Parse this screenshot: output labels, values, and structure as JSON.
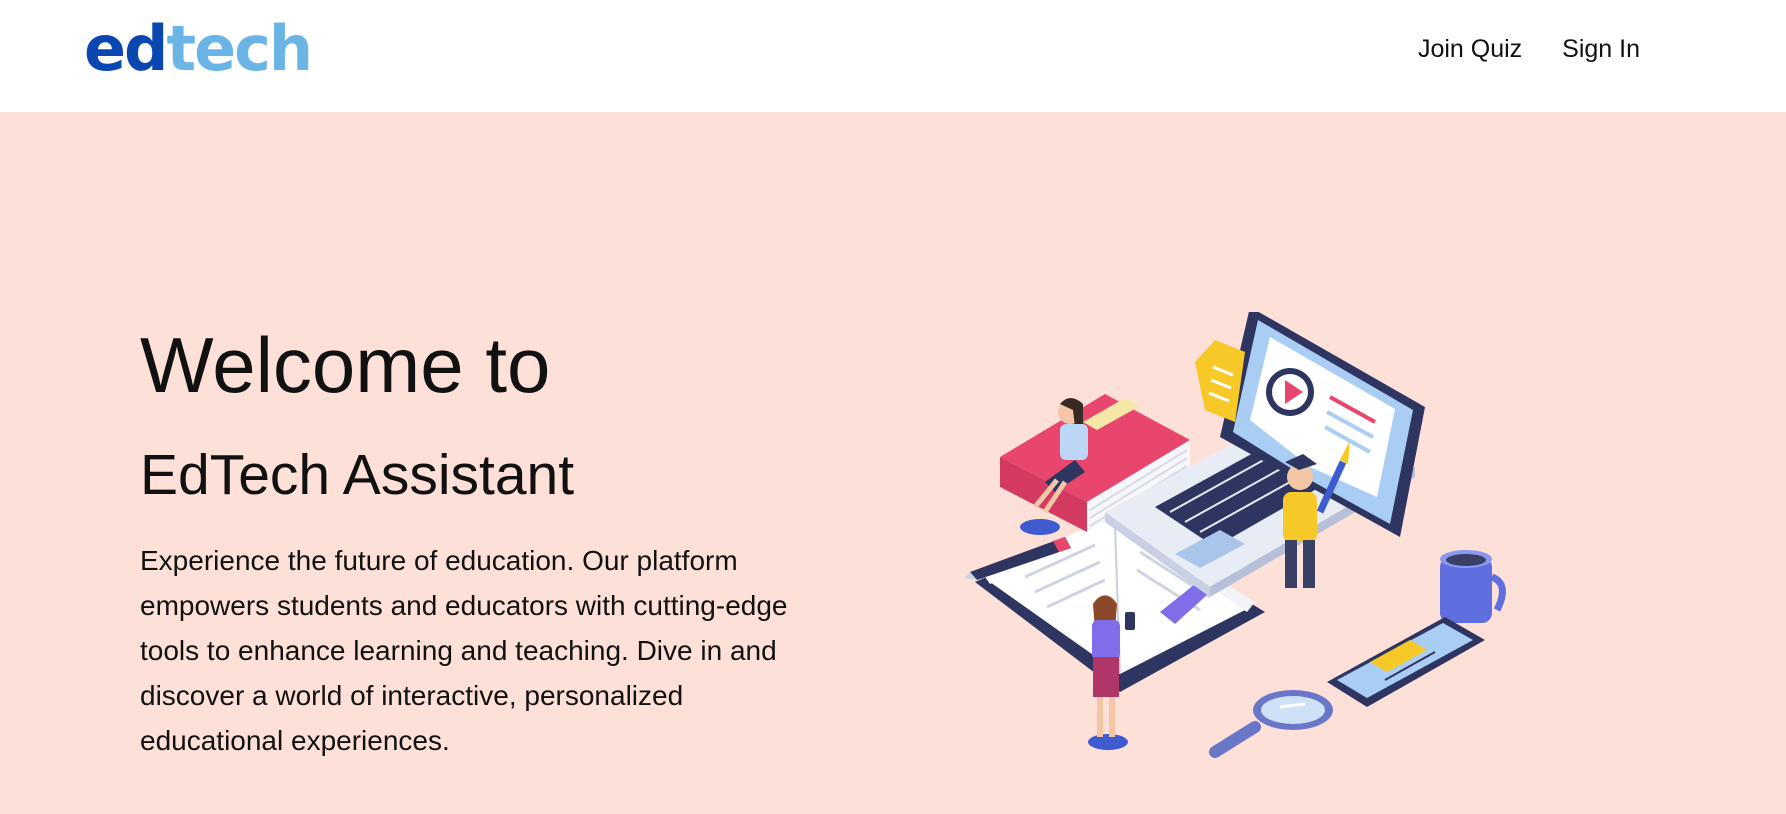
{
  "header": {
    "logo": {
      "part1": "ed",
      "part2": "tech"
    },
    "nav": [
      {
        "label": "Join Quiz"
      },
      {
        "label": "Sign In"
      }
    ]
  },
  "hero": {
    "title": "Welcome to",
    "subtitle": "EdTech Assistant",
    "description": "Experience the future of education. Our platform empowers students and educators with cutting-edge tools to enhance learning and teaching. Dive in and discover a world of interactive, personalized educational experiences."
  },
  "colors": {
    "logo_dark": "#0b47b0",
    "logo_light": "#6ab4e6",
    "hero_background": "#fde0d8",
    "navbar_background": "#ffffff"
  }
}
